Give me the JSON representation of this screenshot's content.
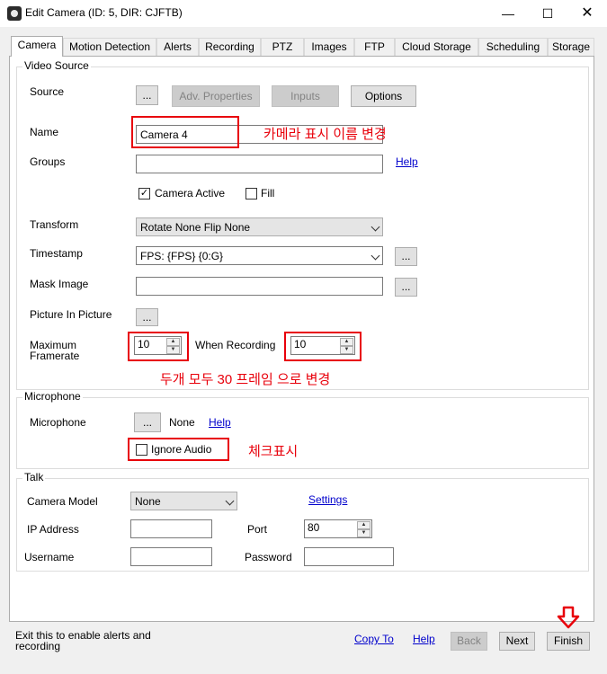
{
  "window": {
    "title": "Edit Camera (ID: 5, DIR: CJFTB)"
  },
  "tabs": [
    "Camera",
    "Motion Detection",
    "Alerts",
    "Recording",
    "PTZ",
    "Images",
    "FTP",
    "Cloud Storage",
    "Scheduling",
    "Storage"
  ],
  "video_source": {
    "legend": "Video Source",
    "source_label": "Source",
    "source_browse": "...",
    "adv_properties": "Adv. Properties",
    "inputs": "Inputs",
    "options": "Options",
    "name_label": "Name",
    "name_value": "Camera 4",
    "groups_label": "Groups",
    "groups_value": "",
    "groups_help": "Help",
    "camera_active_label": "Camera Active",
    "camera_active_checked": true,
    "fill_label": "Fill",
    "fill_checked": false,
    "transform_label": "Transform",
    "transform_value": "Rotate None Flip None",
    "timestamp_label": "Timestamp",
    "timestamp_value": "FPS: {FPS} {0:G}",
    "timestamp_browse": "...",
    "mask_label": "Mask Image",
    "mask_value": "",
    "mask_browse": "...",
    "pip_label": "Picture In Picture",
    "pip_browse": "...",
    "max_framerate_label_1": "Maximum",
    "max_framerate_label_2": "Framerate",
    "max_framerate_value": "10",
    "when_recording_label": "When Recording",
    "when_recording_value": "10"
  },
  "microphone": {
    "legend": "Microphone",
    "label": "Microphone",
    "browse": "...",
    "value": "None",
    "help": "Help",
    "ignore_audio_label": "Ignore Audio",
    "ignore_audio_checked": false
  },
  "talk": {
    "legend": "Talk",
    "camera_model_label": "Camera Model",
    "camera_model_value": "None",
    "settings_link": "Settings",
    "ip_label": "IP Address",
    "ip_value": "",
    "port_label": "Port",
    "port_value": "80",
    "username_label": "Username",
    "username_value": "",
    "password_label": "Password",
    "password_value": ""
  },
  "annotations": {
    "name_note": "카메라 표시 이름 변경",
    "framerate_note": "두개 모두 30 프레임 으로 변경",
    "ignore_note": "체크표시"
  },
  "footer": {
    "hint": "Exit this to enable alerts and recording",
    "copy_to": "Copy To",
    "help": "Help",
    "back": "Back",
    "next": "Next",
    "finish": "Finish"
  },
  "colors": {
    "annotation_red": "#e8000b",
    "link_blue": "#0000cc"
  }
}
